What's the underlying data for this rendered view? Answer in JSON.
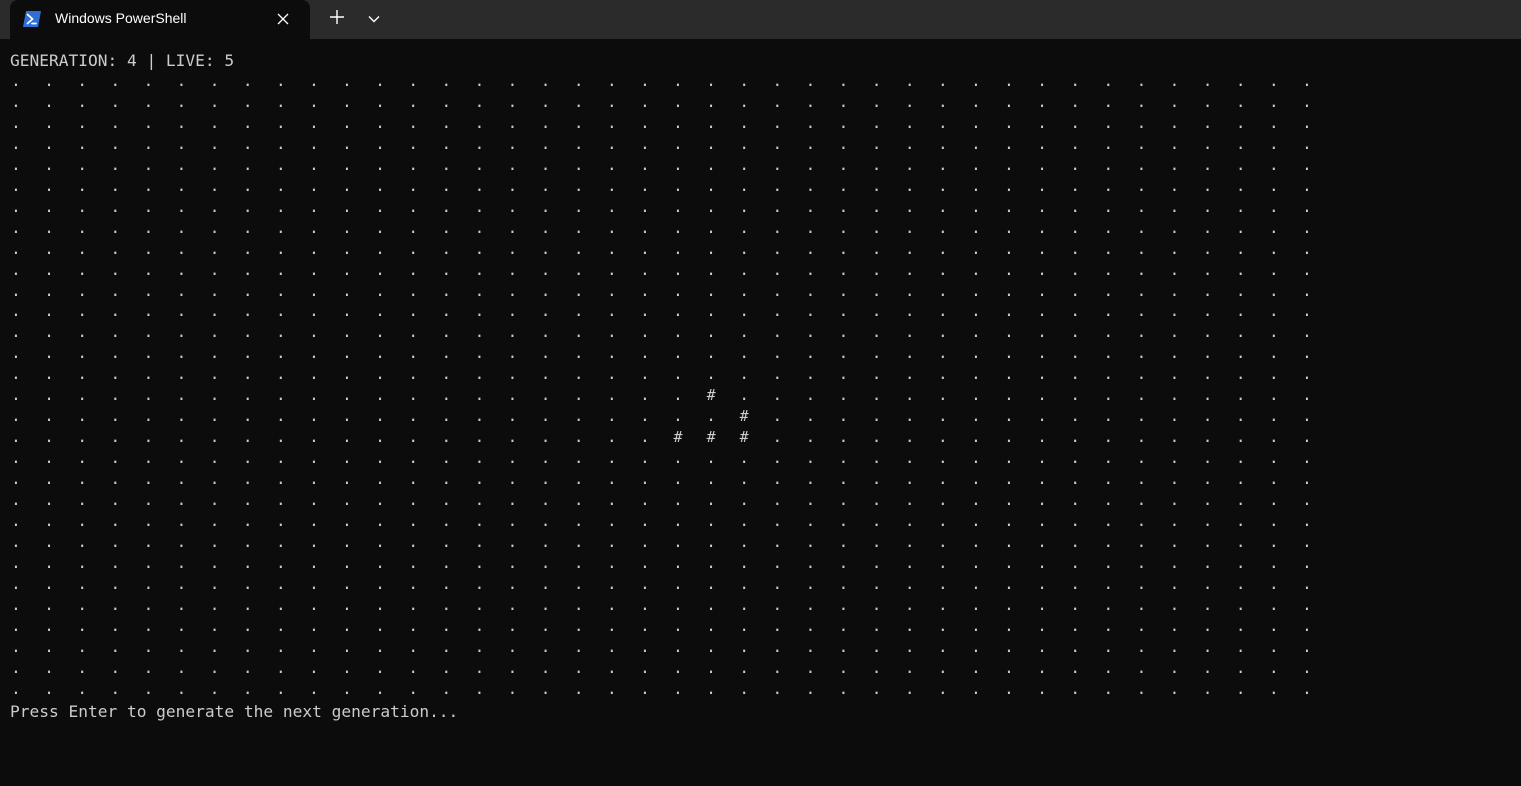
{
  "tab": {
    "title": "Windows PowerShell",
    "icon": "powershell-icon",
    "close_icon": "close-icon"
  },
  "toolbar": {
    "new_tab_icon": "plus-icon",
    "dropdown_icon": "chevron-down-icon"
  },
  "terminal": {
    "status": "GENERATION: 4 | LIVE: 5",
    "prompt": "Press Enter to generate the next generation...",
    "grid": {
      "rows": 30,
      "cols": 40,
      "dead_char": ".",
      "live_char": "#",
      "live_cells": [
        [
          15,
          21
        ],
        [
          16,
          22
        ],
        [
          17,
          20
        ],
        [
          17,
          21
        ],
        [
          17,
          22
        ]
      ]
    }
  },
  "colors": {
    "titlebar_bg": "#2b2b2b",
    "terminal_bg": "#0c0c0c",
    "text": "#cccccc",
    "icon_blue": "#2f6fd6"
  }
}
